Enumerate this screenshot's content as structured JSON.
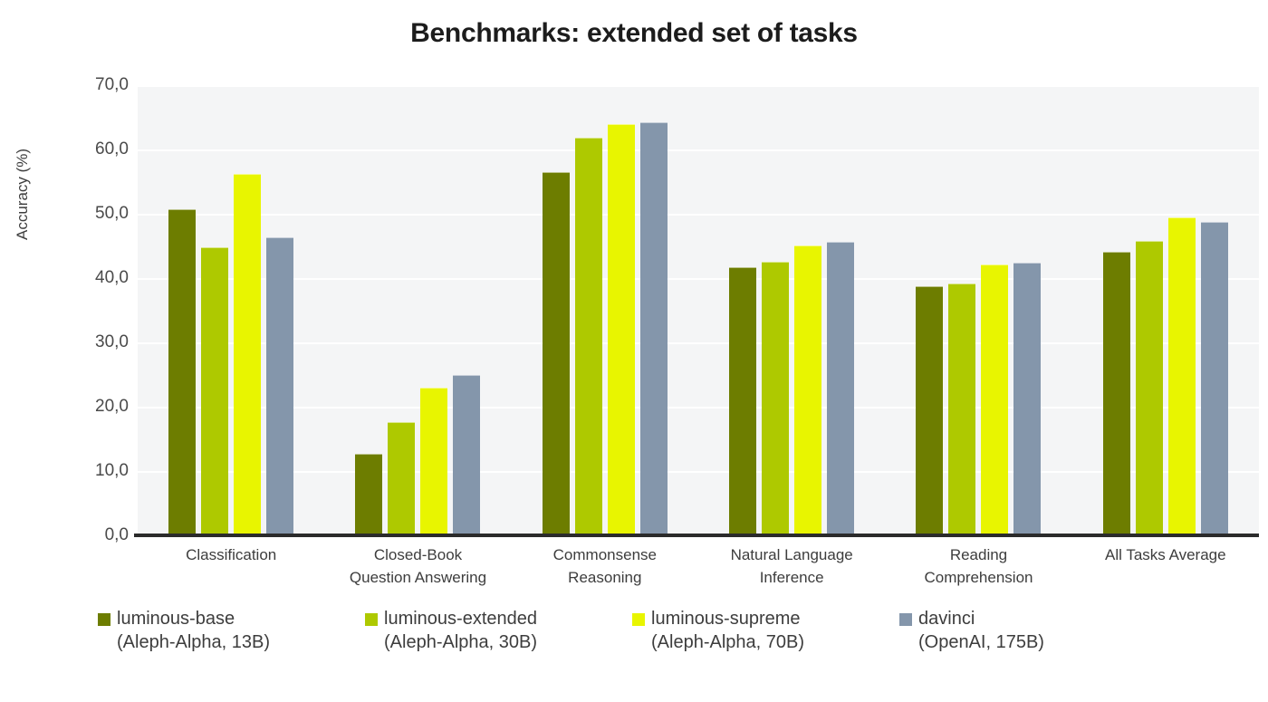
{
  "chart_data": {
    "type": "bar",
    "title": "Benchmarks: extended set of tasks",
    "xlabel": "",
    "ylabel": "Accuracy (%)",
    "ylim": [
      0,
      70
    ],
    "grid": true,
    "legend_position": "bottom",
    "categories": [
      "Classification",
      "Closed-Book Question Answering",
      "Commonsense Reasoning",
      "Natural Language Inference",
      "Reading Comprehension",
      "All Tasks Average"
    ],
    "category_lines": [
      [
        "Classification"
      ],
      [
        "Closed-Book",
        "Question Answering"
      ],
      [
        "Commonsense",
        "Reasoning"
      ],
      [
        "Natural Language",
        "Inference"
      ],
      [
        "Reading",
        "Comprehension"
      ],
      [
        "All Tasks Average"
      ]
    ],
    "y_ticks": [
      0,
      10,
      20,
      30,
      40,
      50,
      60,
      70
    ],
    "y_tick_labels": [
      "0,0",
      "10,0",
      "20,0",
      "30,0",
      "40,0",
      "50,0",
      "60,0",
      "70,0"
    ],
    "series": [
      {
        "name": "luminous-base",
        "sublabel": "(Aleph-Alpha, 13B)",
        "color": "#6D7D00",
        "values": [
          50.7,
          12.7,
          56.5,
          41.7,
          38.7,
          44.1
        ]
      },
      {
        "name": "luminous-extended",
        "sublabel": "(Aleph-Alpha, 30B)",
        "color": "#AEC900",
        "values": [
          44.8,
          17.6,
          61.9,
          42.6,
          39.2,
          45.8
        ]
      },
      {
        "name": "luminous-supreme",
        "sublabel": "(Aleph-Alpha, 70B)",
        "color": "#E8F500",
        "values": [
          56.2,
          22.9,
          63.9,
          45.1,
          42.1,
          49.4
        ]
      },
      {
        "name": "davinci",
        "sublabel": "(OpenAI, 175B)",
        "color": "#8496AB",
        "values": [
          46.4,
          25.0,
          64.2,
          45.6,
          42.4,
          48.8
        ]
      }
    ]
  },
  "style": {
    "plot_background": "#F4F5F6",
    "gridline_color": "#FFFFFF",
    "axis_color": "#2B2B2B",
    "text_color": "#3D3D3D",
    "title_color": "#1C1C1C"
  }
}
